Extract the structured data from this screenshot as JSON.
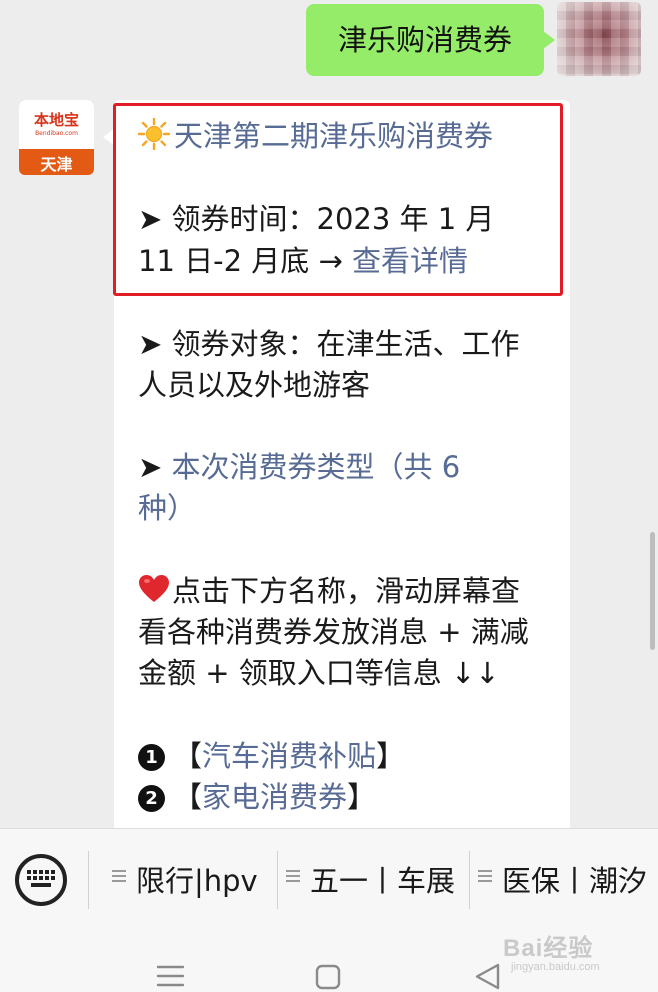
{
  "chat": {
    "outgoing": {
      "text": "津乐购消费券"
    },
    "sender": {
      "logo": "本地宝",
      "site": "Bendibao.com",
      "city": "天津"
    },
    "card": {
      "title": "天津第二期津乐购消费券",
      "time_label": "➤ 领券时间：2023 年 1 月",
      "time_end": "11 日-2 月底 → ",
      "detail_link": "查看详情",
      "target_line1": "➤ 领券对象：在津生活、工作",
      "target_line2": "人员以及外地游客",
      "types_arrow": "➤ ",
      "types_line1": "本次消费券类型（共 6",
      "types_line2": "种）",
      "hint_line1": "点击下方名称，滑动屏幕查",
      "hint_line2": "看各种消费券发放消息 + 满减",
      "hint_line3": "金额 + 领取入口等信息 ↓↓",
      "items": [
        {
          "num": "1",
          "open": "【",
          "label": "汽车消费补贴",
          "close": "】"
        },
        {
          "num": "2",
          "open": "【",
          "label": "家电消费券",
          "close": "】"
        }
      ],
      "icons": {
        "title_icon": "sun-icon",
        "hint_icon": "heart-icon"
      }
    }
  },
  "menu": {
    "items": [
      {
        "label": "限行|hpv"
      },
      {
        "label": "五一丨车展"
      },
      {
        "label": "医保丨潮汐"
      }
    ]
  },
  "watermark": {
    "main": "Bai经验",
    "sub": "jingyan.baidu.com"
  },
  "colors": {
    "link": "#576b95",
    "bubble": "#95ec69",
    "highlight": "#e21c24"
  }
}
